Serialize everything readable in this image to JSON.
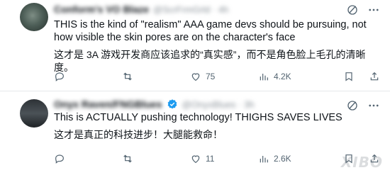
{
  "tweets": [
    {
      "display_name": "Conform's VO Blaze",
      "handle": "@ScrFrmGrld · 4h",
      "text_en": "THIS is the kind of \"realism\" AAA game devs should be pursuing, not how visible the skin pores are on the character's face",
      "text_zh": "这才是 3A 游戏开发商应该追求的“真实感”，而不是角色脸上毛孔的清晰度。",
      "replies": "",
      "reposts": "",
      "likes": "75",
      "views": "4.2K"
    },
    {
      "display_name": "Onyx Raven/FNGBlues",
      "handle": "@OnyxBlues · 3h",
      "text_en": "This is ACTUALLY pushing technology! THIGHS SAVES LIVES",
      "text_zh": "这才是真正的科技进步！大腿能救命！",
      "replies": "",
      "reposts": "",
      "likes": "11",
      "views": "2.6K"
    }
  ],
  "watermark": "XIBO",
  "icons": {
    "grok": "slash-circle-icon",
    "more": "more-dots-icon",
    "reply": "reply-bubble-icon",
    "repost": "repost-arrows-icon",
    "like": "heart-icon",
    "views": "views-bar-chart-icon",
    "bookmark": "bookmark-icon",
    "share": "share-upload-icon",
    "verified": "verified-badge-icon"
  },
  "colors": {
    "text": "#0f1419",
    "muted": "#536471",
    "verified": "#1d9bf0",
    "divider": "#e6e8ea"
  }
}
